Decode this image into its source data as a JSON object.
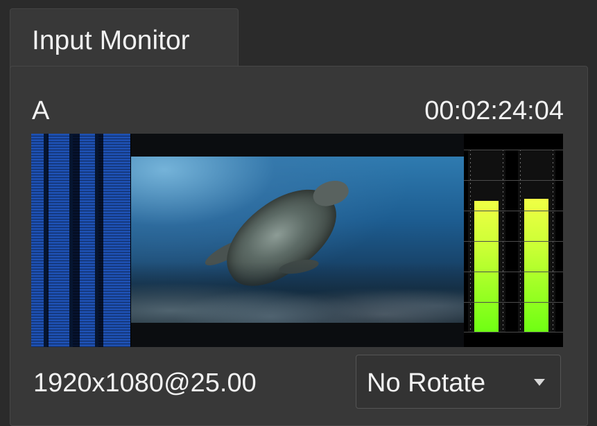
{
  "header": {
    "tab_label": "Input Monitor"
  },
  "monitor": {
    "channel": "A",
    "timecode": "00:02:24:04",
    "resolution": "1920x1080@25.00",
    "audio_levels": [
      0.72,
      0.73
    ]
  },
  "controls": {
    "rotation": "No Rotate"
  },
  "icons": {
    "dropdown": "chevron-down-icon"
  },
  "colors": {
    "accent_green": "#6fff13",
    "accent_yellow": "#f0ff45",
    "wave_blue": "#1d4fb0"
  }
}
